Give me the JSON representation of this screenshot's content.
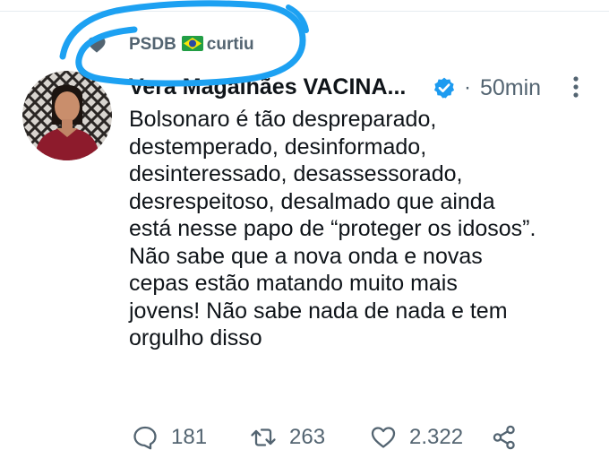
{
  "context": {
    "account": "PSDB",
    "flag": "🇧🇷",
    "action": "curtiu"
  },
  "tweet": {
    "author_name": "Vera Magalhães VACINA...",
    "time": "50min",
    "separator": "·",
    "lines": [
      "Bolsonaro é tão despreparado,",
      "destemperado, desinformado,",
      "desinteressado, desassessorado,",
      "desrespeitoso, desalmado que ainda",
      "está nesse papo de “proteger os idosos”.",
      "Não sabe que a nova onda e novas",
      "cepas estão matando muito mais",
      "jovens! Não sabe nada de nada e tem",
      "orgulho disso"
    ]
  },
  "actions": {
    "replies": "181",
    "retweets": "263",
    "likes": "2.322"
  },
  "colors": {
    "text": "#0f1419",
    "muted": "#536471",
    "verified": "#1d9bf0",
    "annotation": "#1da1f2"
  }
}
